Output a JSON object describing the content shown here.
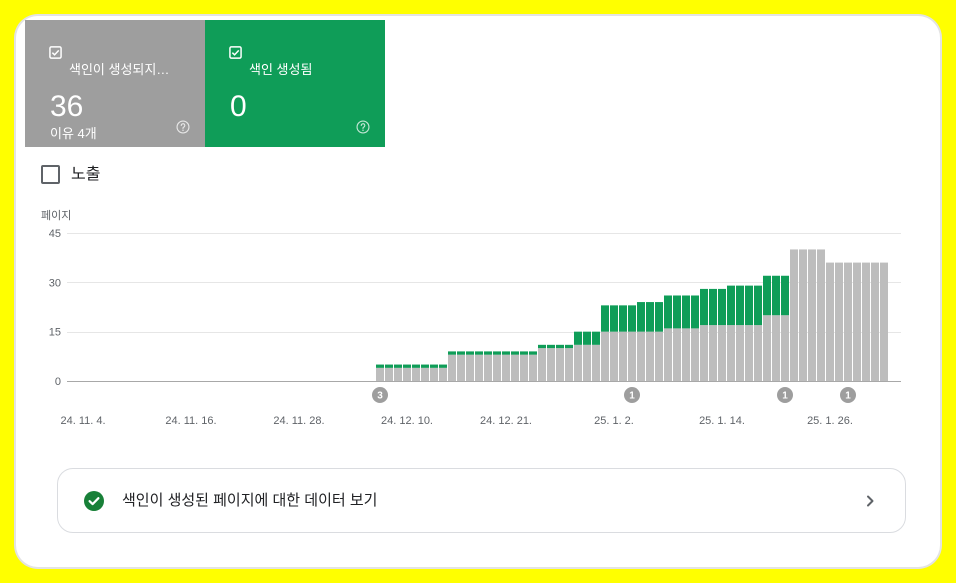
{
  "tiles": [
    {
      "checked": true,
      "count": 36,
      "subtitle": "이유 4개",
      "background": "#9e9e9e",
      "checkbox_icon": "checkbox-checked-icon",
      "help_icon": "help-circle-icon"
    },
    {
      "checked": true,
      "count": 0,
      "background": "#0f9d58",
      "checkbox_icon": "checkbox-checked-icon",
      "help_icon": "help-circle-icon"
    }
  ],
  "impressions_toggle": {
    "label": "노출",
    "checked": false
  },
  "chart_data": {
    "type": "bar",
    "stacked": true,
    "ylabel": "페이지",
    "ylim": [
      0,
      45
    ],
    "yticks": [
      0,
      15,
      30,
      45
    ],
    "grid": true,
    "xticks": [
      "24. 11. 4.",
      "24. 11. 16.",
      "24. 11. 28.",
      "24. 12. 10.",
      "24. 12. 21.",
      "25. 1. 2.",
      "25. 1. 14.",
      "25. 1. 26."
    ],
    "x": [
      "2024-12-07",
      "2024-12-08",
      "2024-12-09",
      "2024-12-10",
      "2024-12-11",
      "2024-12-12",
      "2024-12-13",
      "2024-12-14",
      "2024-12-15",
      "2024-12-16",
      "2024-12-17",
      "2024-12-18",
      "2024-12-19",
      "2024-12-20",
      "2024-12-21",
      "2024-12-22",
      "2024-12-23",
      "2024-12-24",
      "2024-12-25",
      "2024-12-26",
      "2024-12-27",
      "2024-12-28",
      "2024-12-29",
      "2024-12-30",
      "2024-12-31",
      "2025-01-01",
      "2025-01-02",
      "2025-01-03",
      "2025-01-04",
      "2025-01-05",
      "2025-01-06",
      "2025-01-07",
      "2025-01-08",
      "2025-01-09",
      "2025-01-10",
      "2025-01-11",
      "2025-01-12",
      "2025-01-13",
      "2025-01-14",
      "2025-01-15",
      "2025-01-16",
      "2025-01-17",
      "2025-01-18",
      "2025-01-19",
      "2025-01-20",
      "2025-01-21",
      "2025-01-22",
      "2025-01-23",
      "2025-01-24",
      "2025-01-25",
      "2025-01-26",
      "2025-01-27",
      "2025-01-28",
      "2025-01-29",
      "2025-01-30",
      "2025-01-31",
      "2025-02-01"
    ],
    "series": [
      {
        "name": "색인이 생성되지…",
        "color": "#bdbdbd",
        "values": [
          4,
          4,
          4,
          4,
          4,
          4,
          4,
          4,
          8,
          8,
          8,
          8,
          8,
          8,
          8,
          8,
          8,
          8,
          10,
          10,
          10,
          10,
          11,
          11,
          11,
          15,
          15,
          15,
          15,
          15,
          15,
          15,
          16,
          16,
          16,
          16,
          17,
          17,
          17,
          17,
          17,
          17,
          17,
          20,
          20,
          20,
          40,
          40,
          40,
          40,
          36,
          36,
          36,
          36,
          36,
          36,
          36
        ]
      },
      {
        "name": "색인 생성됨",
        "color": "#0f9d58",
        "values": [
          1,
          1,
          1,
          1,
          1,
          1,
          1,
          1,
          1,
          1,
          1,
          1,
          1,
          1,
          1,
          1,
          1,
          1,
          1,
          1,
          1,
          1,
          4,
          4,
          4,
          8,
          8,
          8,
          8,
          9,
          9,
          9,
          10,
          10,
          10,
          10,
          11,
          11,
          11,
          12,
          12,
          12,
          12,
          12,
          12,
          12,
          0,
          0,
          0,
          0,
          0,
          0,
          0,
          0,
          0,
          0,
          0
        ]
      }
    ],
    "annotations": [
      {
        "date": "2024-12-07",
        "label": "3"
      },
      {
        "date": "2025-01-04",
        "label": "1"
      },
      {
        "date": "2025-01-21",
        "label": "1"
      },
      {
        "date": "2025-01-28",
        "label": "1"
      }
    ],
    "annotation_color": "#9e9e9e"
  },
  "link_card": {
    "label": "색인이 생성된 페이지에 대한 데이터 보기",
    "icon": "check-circle-icon",
    "icon_color": "#188038",
    "chevron_icon": "chevron-right-icon"
  }
}
